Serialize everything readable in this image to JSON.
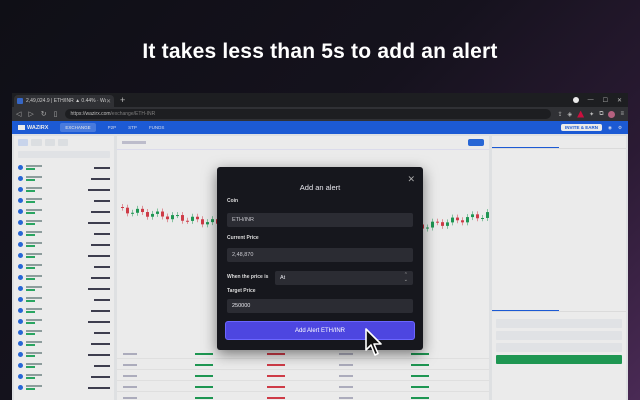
{
  "headline": "It takes less than 5s to add an alert",
  "browser": {
    "tab_title": "2,49,024.9 | ETH/INR ▲ 0.44% · WazirX",
    "url_host": "https://wazirx.com",
    "url_path": "/exchange/ETH-INR"
  },
  "site": {
    "logo": "WAZIRX",
    "nav": [
      "EXCHANGE",
      "P2P",
      "STP",
      "FUNDS"
    ],
    "nav_right": "INVITE & EARN"
  },
  "modal": {
    "title": "Add an alert",
    "coin_label": "Coin",
    "coin_value": "ETH/INR",
    "current_price_label": "Current Price",
    "current_price_value": "2,48,870",
    "condition_label": "When the price is",
    "condition_value": "At",
    "target_price_label": "Target Price",
    "target_price_value": "250000",
    "submit_label": "Add Alert ETH/INR"
  },
  "colors": {
    "accent": "#4d46e0",
    "brand": "#1f62e6",
    "buy": "#21a35a",
    "sell": "#e0404e"
  }
}
